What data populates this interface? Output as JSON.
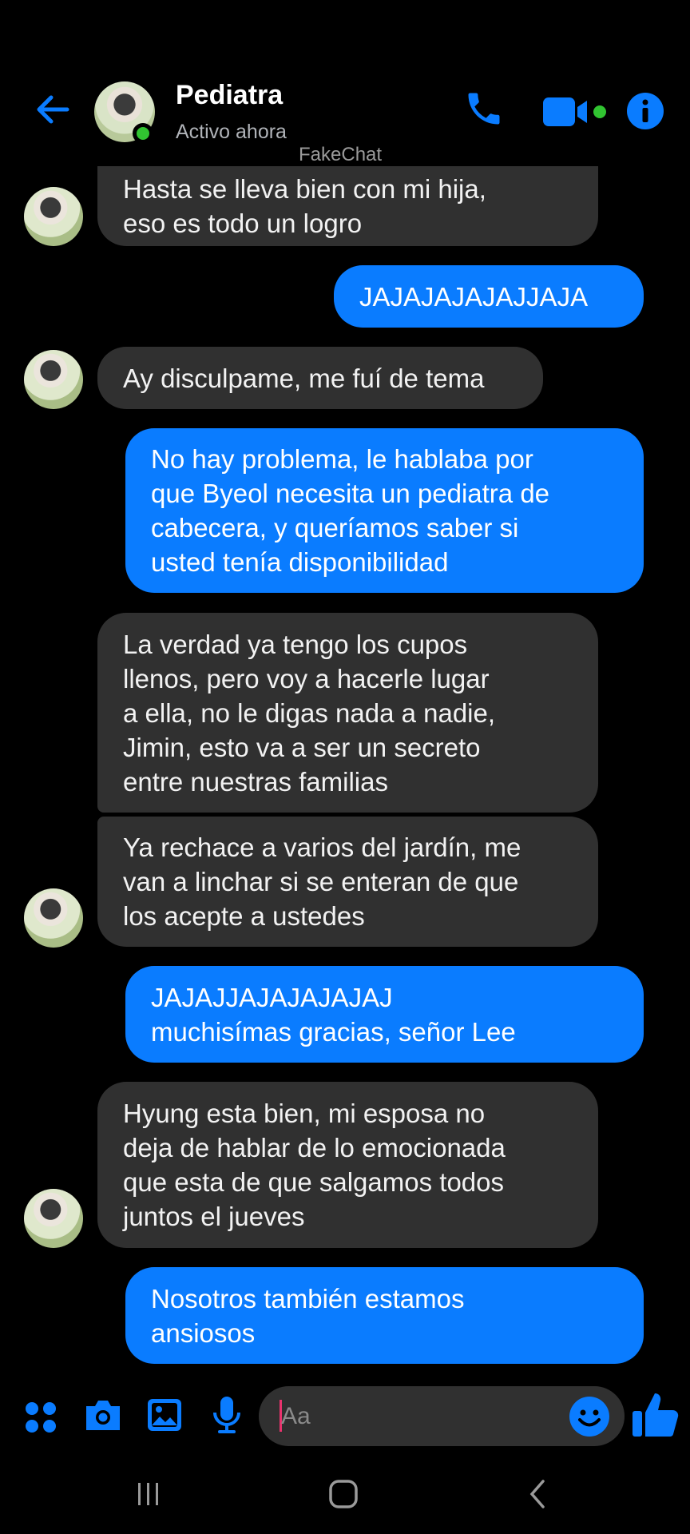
{
  "header": {
    "contact_name": "Pediatra",
    "status": "Activo ahora",
    "watermark": "FakeChat",
    "icons": [
      "back-arrow-icon",
      "phone-icon",
      "video-icon",
      "info-icon"
    ]
  },
  "messages": [
    {
      "from": "them",
      "text": "Hasta se lleva bien con mi hija,\neso es todo un logro"
    },
    {
      "from": "me",
      "text": "JAJAJAJAJAJJAJA"
    },
    {
      "from": "them",
      "text": "Ay disculpame, me fuí de tema"
    },
    {
      "from": "me",
      "text": "No hay problema, le hablaba por\nque Byeol necesita un pediatra de\ncabecera,  y queríamos saber si\nusted tenía disponibilidad"
    },
    {
      "from": "them",
      "text": "La verdad ya tengo los cupos\nllenos, pero voy a hacerle lugar\na ella, no le digas nada a nadie,\nJimin, esto va a ser un secreto\nentre nuestras familias"
    },
    {
      "from": "them",
      "text": "Ya rechace a varios del jardín, me\nvan a linchar si se enteran de que\nlos acepte a ustedes"
    },
    {
      "from": "me",
      "text": "JAJAJJAJAJAJAJAJ\nmuchisímas gracias, señor Lee"
    },
    {
      "from": "them",
      "text": "Hyung esta bien, mi esposa no\ndeja de hablar de lo emocionada\nque esta de que salgamos todos\njuntos el jueves"
    },
    {
      "from": "me",
      "text": "Nosotros también estamos\nansiosos"
    }
  ],
  "composer": {
    "placeholder": "Aa",
    "icons": [
      "apps-icon",
      "camera-icon",
      "gallery-icon",
      "microphone-icon",
      "emoji-icon",
      "thumbs-up-icon"
    ]
  },
  "system_nav": {
    "icons": [
      "recents-icon",
      "home-icon",
      "back-icon"
    ]
  },
  "colors": {
    "accent": "#0a7cff",
    "incoming_bubble": "#303030",
    "online": "#31c431",
    "background": "#000000"
  }
}
